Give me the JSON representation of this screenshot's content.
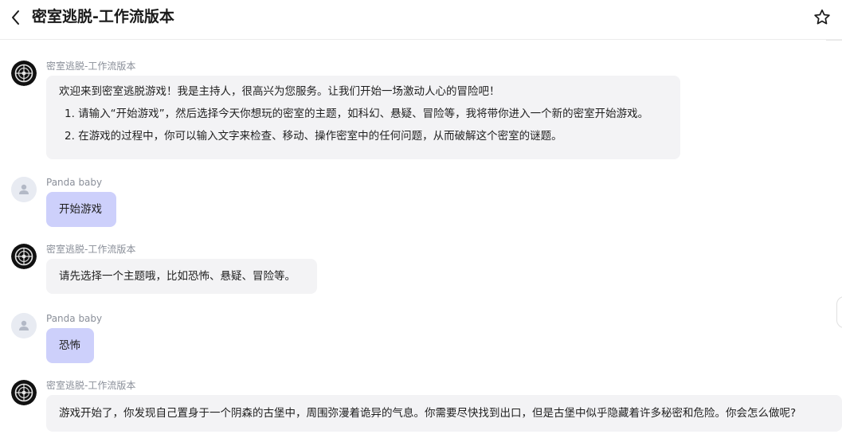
{
  "header": {
    "title": "密室逃脱-工作流版本"
  },
  "icons": {
    "back": "chevron-left-icon",
    "favorite": "star-icon",
    "bot_avatar": "bot-avatar",
    "user_avatar": "user-avatar"
  },
  "colors": {
    "user_bubble": "#cdd0fb",
    "bot_bubble": "#f3f3f5",
    "sender_name": "#8a8f99"
  },
  "messages": [
    {
      "sender": "密室逃脱-工作流版本",
      "intro": "欢迎来到密室逃脱游戏！我是主持人，很高兴为您服务。让我们开始一场激动人心的冒险吧！",
      "items": [
        "1. 请输入“开始游戏”，然后选择今天你想玩的密室的主题，如科幻、悬疑、冒险等，我将带你进入一个新的密室开始游戏。",
        "2. 在游戏的过程中，你可以输入文字来检查、移动、操作密室中的任何问题，从而破解这个密室的谜题。"
      ]
    },
    {
      "sender": "Panda baby",
      "text": "开始游戏"
    },
    {
      "sender": "密室逃脱-工作流版本",
      "text": "请先选择一个主题哦，比如恐怖、悬疑、冒险等。"
    },
    {
      "sender": "Panda baby",
      "text": "恐怖"
    },
    {
      "sender": "密室逃脱-工作流版本",
      "text": "游戏开始了，你发现自己置身于一个阴森的古堡中，周围弥漫着诡异的气息。你需要尽快找到出口，但是古堡中似乎隐藏着许多秘密和危险。你会怎么做呢?"
    }
  ]
}
